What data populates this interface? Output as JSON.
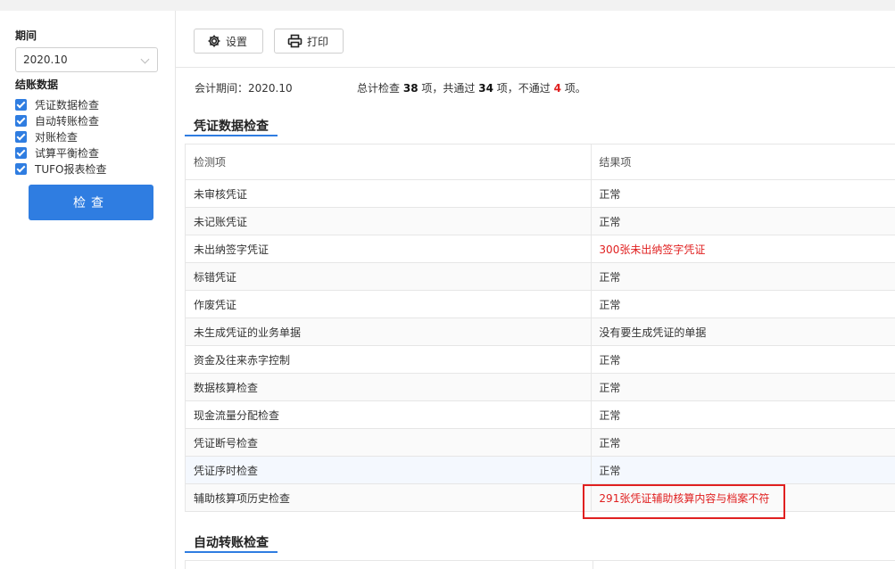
{
  "sidebar": {
    "period_label": "期间",
    "period_value": "2020.10",
    "closing_label": "结账数据",
    "items": [
      {
        "label": "凭证数据检查",
        "checked": true
      },
      {
        "label": "自动转账检查",
        "checked": true
      },
      {
        "label": "对账检查",
        "checked": true
      },
      {
        "label": "试算平衡检查",
        "checked": true
      },
      {
        "label": "TUFO报表检查",
        "checked": true
      }
    ],
    "check_button": "检查"
  },
  "toolbar": {
    "settings_label": "设置",
    "print_label": "打印"
  },
  "summary": {
    "period_text": "会计期间：2020.10",
    "prefix": "总计检查",
    "total": "38",
    "mid1": "项，共通过",
    "passed": "34",
    "mid2": "项，不通过",
    "failed": "4",
    "suffix": "项。"
  },
  "section1": {
    "title": "凭证数据检查",
    "header": {
      "col1": "检测项",
      "col2": "结果项"
    },
    "rows": [
      {
        "item": "未审核凭证",
        "result": "正常",
        "status": "ok"
      },
      {
        "item": "未记账凭证",
        "result": "正常",
        "status": "ok"
      },
      {
        "item": "未出纳签字凭证",
        "result": "300张未出纳签字凭证",
        "status": "error"
      },
      {
        "item": "标错凭证",
        "result": "正常",
        "status": "ok"
      },
      {
        "item": "作废凭证",
        "result": "正常",
        "status": "ok"
      },
      {
        "item": "未生成凭证的业务单据",
        "result": "没有要生成凭证的单据",
        "status": "ok"
      },
      {
        "item": "资金及往来赤字控制",
        "result": "正常",
        "status": "ok"
      },
      {
        "item": "数据核算检查",
        "result": "正常",
        "status": "ok"
      },
      {
        "item": "现金流量分配检查",
        "result": "正常",
        "status": "ok"
      },
      {
        "item": "凭证断号检查",
        "result": "正常",
        "status": "ok"
      },
      {
        "item": "凭证序时检查",
        "result": "正常",
        "status": "ok"
      },
      {
        "item": "辅助核算项历史检查",
        "result": "291张凭证辅助核算内容与档案不符",
        "status": "error"
      }
    ]
  },
  "section2": {
    "title": "自动转账检查"
  },
  "colors": {
    "accent": "#2f7de1",
    "error": "#e02020"
  }
}
